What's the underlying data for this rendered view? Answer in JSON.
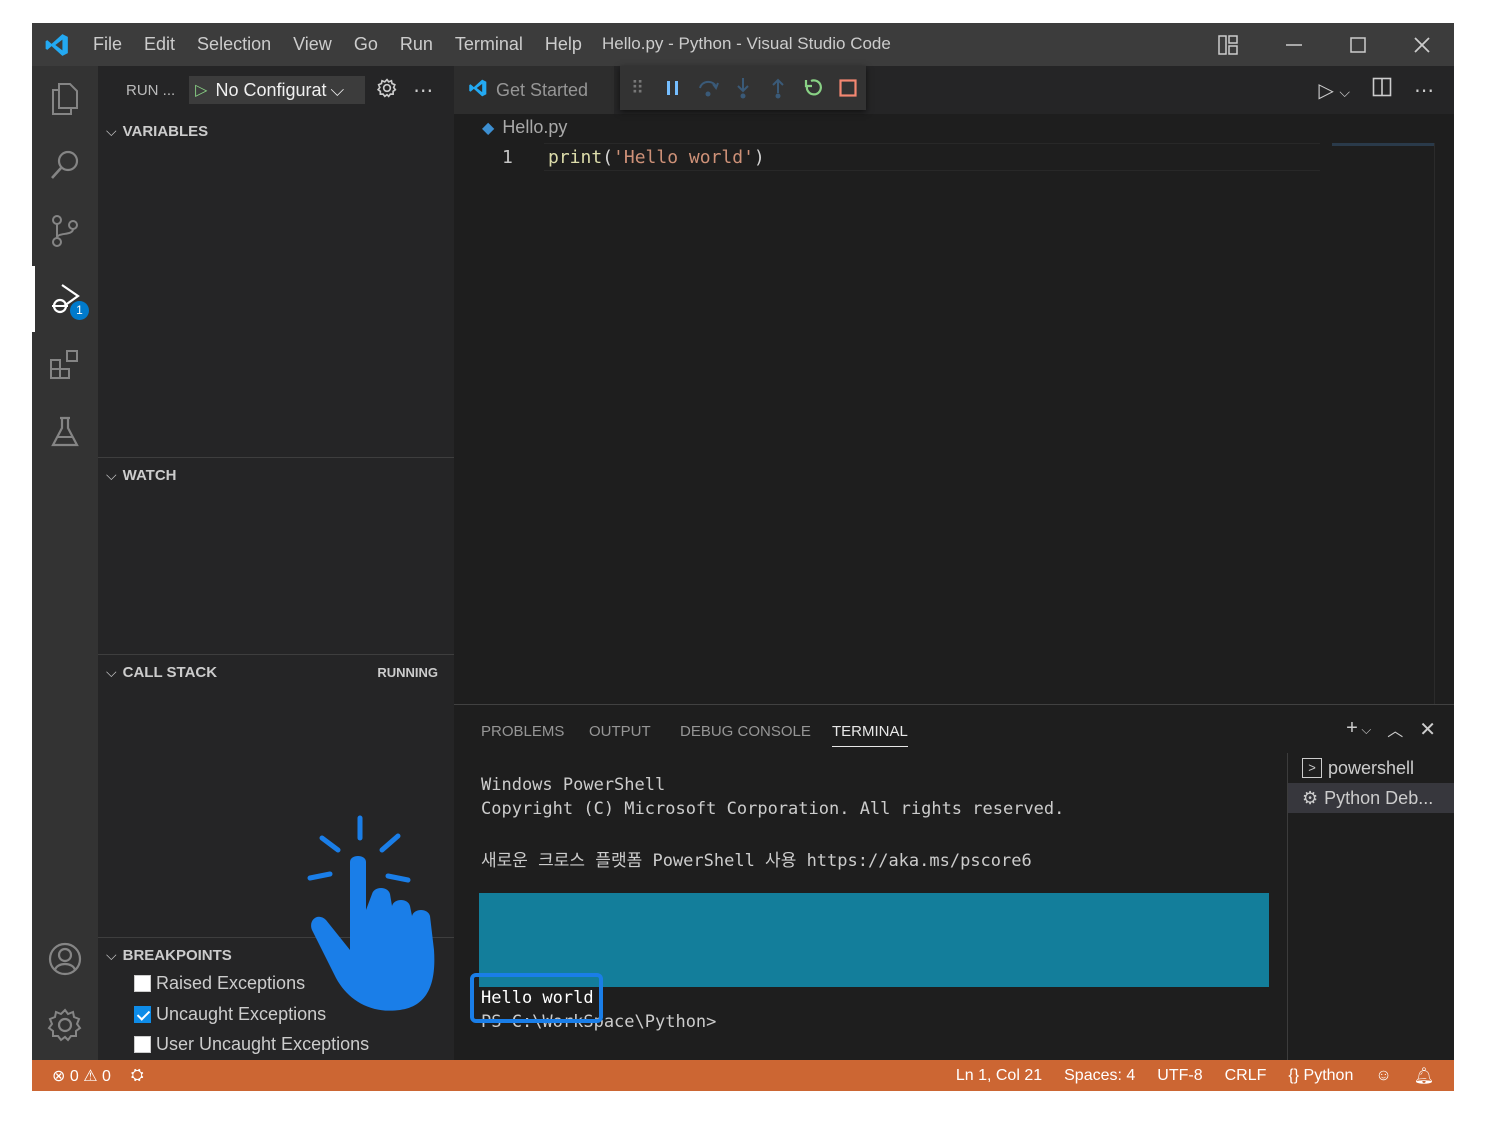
{
  "titlebar": {
    "menu": [
      "File",
      "Edit",
      "Selection",
      "View",
      "Go",
      "Run",
      "Terminal",
      "Help"
    ],
    "title": "Hello.py - Python - Visual Studio Code"
  },
  "activity": {
    "items": [
      "explorer-icon",
      "search-icon",
      "source-control-icon",
      "run-debug-icon",
      "extensions-icon",
      "testing-icon",
      "account-icon",
      "settings-gear-icon"
    ],
    "debug_badge": "1"
  },
  "sidebar": {
    "run_label": "RUN ...",
    "config_value": "No Configurat",
    "sections": {
      "variables": "VARIABLES",
      "watch": "WATCH",
      "call_stack": "CALL STACK",
      "call_stack_status": "RUNNING",
      "breakpoints": "BREAKPOINTS"
    },
    "breakpoints": [
      {
        "label": "Raised Exceptions",
        "checked": false
      },
      {
        "label": "Uncaught Exceptions",
        "checked": true
      },
      {
        "label": "User Uncaught Exceptions",
        "checked": false
      }
    ]
  },
  "editor": {
    "tab_label": "Get Started",
    "breadcrumb_file": "Hello.py",
    "line_number": "1",
    "code": {
      "fn": "print",
      "open": "(",
      "str": "'Hello world'",
      "close": ")"
    }
  },
  "panel": {
    "tabs": [
      "PROBLEMS",
      "OUTPUT",
      "DEBUG CONSOLE",
      "TERMINAL"
    ],
    "active_tab": "TERMINAL",
    "terminal_lines": [
      "Windows PowerShell",
      "Copyright (C) Microsoft Corporation. All rights reserved.",
      "새로운 크로스 플랫폼 PowerShell 사용 https://aka.ms/pscore6",
      "Hello world",
      "PS C:\\WorkSpace\\Python>"
    ],
    "terminals": [
      "powershell",
      "Python Deb..."
    ]
  },
  "status": {
    "errors": "0",
    "warnings": "0",
    "position": "Ln 1, Col 21",
    "spaces": "Spaces: 4",
    "encoding": "UTF-8",
    "eol": "CRLF",
    "language": "Python"
  },
  "colors": {
    "status_bar": "#cc6633",
    "accent": "#007acc",
    "highlight_box": "#1a7ee8"
  }
}
